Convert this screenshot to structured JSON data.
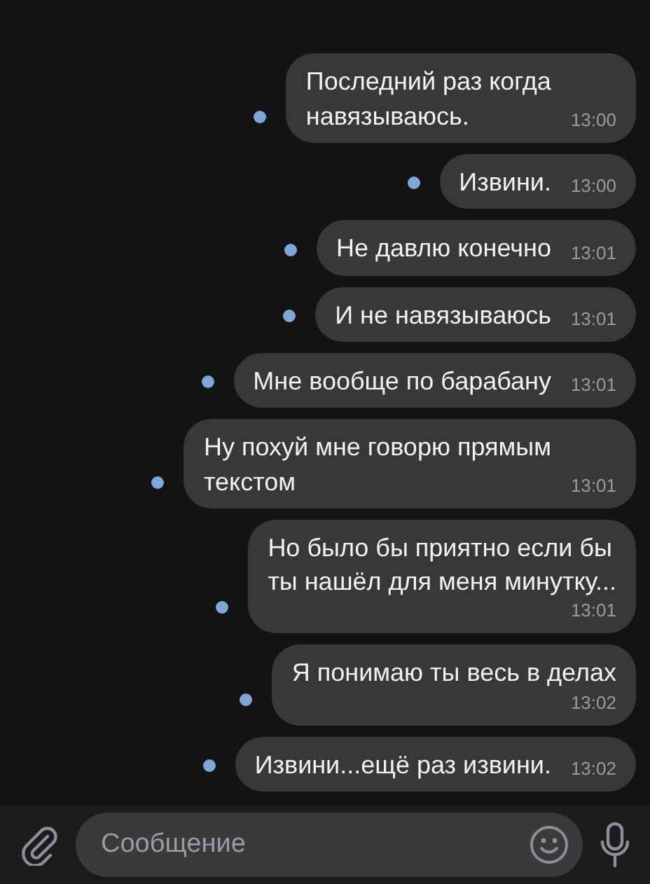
{
  "messages": [
    {
      "text": "Последний раз когда\nнавязываюсь.",
      "time": "13:00",
      "unread": true,
      "time_below": false
    },
    {
      "text": "Извини.",
      "time": "13:00",
      "unread": true,
      "time_below": false
    },
    {
      "text": "Не давлю конечно",
      "time": "13:01",
      "unread": true,
      "time_below": false
    },
    {
      "text": "И не навязываюсь",
      "time": "13:01",
      "unread": true,
      "time_below": false
    },
    {
      "text": "Мне вообще по барабану",
      "time": "13:01",
      "unread": true,
      "time_below": false
    },
    {
      "text": "Ну похуй мне говорю прямым\nтекстом",
      "time": "13:01",
      "unread": true,
      "time_below": false
    },
    {
      "text": "Но было бы приятно если бы\nты нашёл для меня минутку...",
      "time": "13:01",
      "unread": true,
      "time_below": true
    },
    {
      "text": "Я понимаю ты весь в делах",
      "time": "13:02",
      "unread": true,
      "time_below": true
    },
    {
      "text": "Извини...ещё раз извини.",
      "time": "13:02",
      "unread": true,
      "time_below": false
    }
  ],
  "composer": {
    "placeholder": "Сообщение"
  }
}
